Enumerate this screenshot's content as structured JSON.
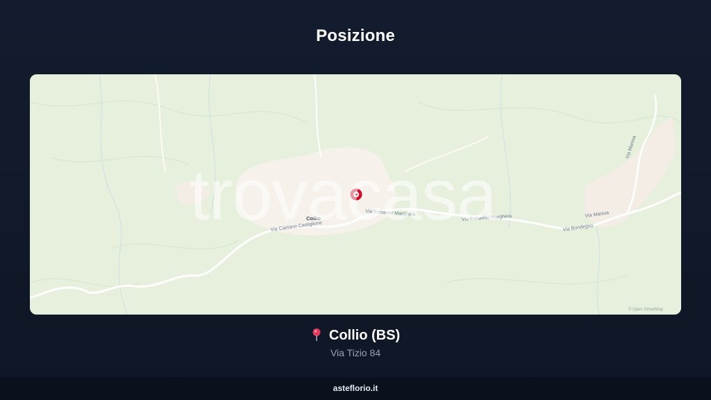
{
  "page": {
    "title": "Posizione"
  },
  "map": {
    "watermark": "trovacasa",
    "place_label": "Collio",
    "roads": [
      "Via Caetano Castiglione",
      "Via Ermanno Marghera",
      "Via Ermanno Marghera",
      "Via Bondegno",
      "Via Maniva",
      "Via Maniva"
    ],
    "attribution": "© Open StreetMap",
    "colors": {
      "land": "#e6f0dd",
      "town": "#f7f1ec",
      "road": "#ffffff",
      "pin": "#c8102e"
    }
  },
  "location": {
    "icon": "pin-icon",
    "name": "Collio (BS)",
    "address": "Via Tizio 84"
  },
  "footer": {
    "site": "asteflorio.it"
  }
}
